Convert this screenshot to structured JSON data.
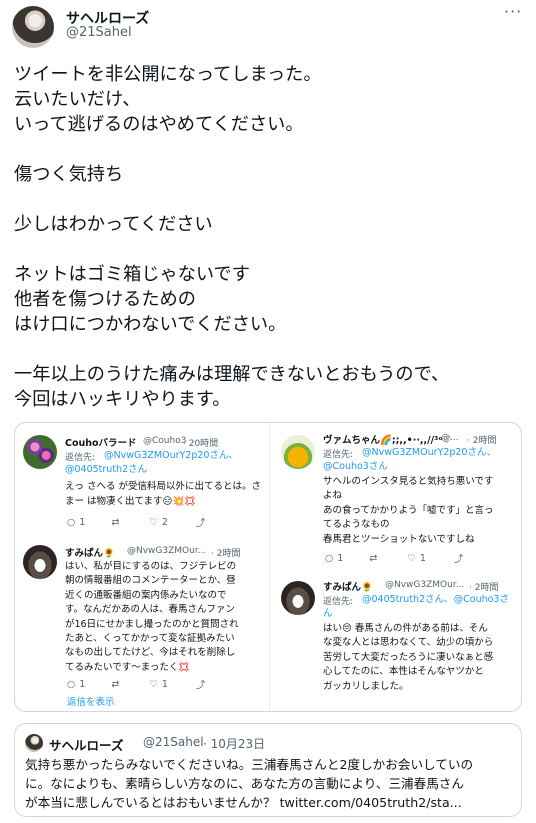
{
  "author": {
    "name": "サヘルローズ",
    "handle": "@21Sahel"
  },
  "more_label": "···",
  "body_lines": [
    "ツイートを非公開になってしまった。",
    "云いたいだけ、",
    "いって逃げるのはやめてください。",
    "",
    "傷つく気持ち",
    "",
    "少しはわかってください",
    "",
    "ネットはゴミ箱じゃないです",
    "他者を傷つけるための",
    "はけ口につかわないでください。",
    "",
    "一年以上のうけた痛みは理解できないとおもうので、",
    "今回はハッキリやります。"
  ],
  "screenshot": {
    "left": {
      "reply1": {
        "name": "Couhoバラード",
        "handle": "@Couho3",
        "time": "· 20時間",
        "reply_prefix": "返信先:",
        "reply_to1": "@NvwG3ZMOurY2p20さん、",
        "reply_to2": "@0405truth2さん",
        "text1": "えっ さへる が受信料局以外に出てるとは。さまー は物凄く出てます😑💥💢",
        "acts": {
          "reply": "1",
          "like": "2"
        }
      },
      "reply2": {
        "name": "すみぱん🌻",
        "handle": "@NvwG3ZMOur...",
        "time": "· 2時間",
        "lines": [
          "はい、私が目にするのは、フジテレビの",
          "朝の情報番組のコメンテーターとか、昼",
          "近くの通販番組の案内係みたいなので",
          "す。なんだかあの人は、春馬さんファン",
          "が16日にせかまし撮ったのかと質問され",
          "たあと、くってかかって変な証拠みたい",
          "なもの出してたけど、今はそれを削除し",
          "てるみたいです〜まったく💢"
        ],
        "acts": {
          "reply": "1",
          "like": "1"
        },
        "show_replies": "返信を表示"
      }
    },
    "right": {
      "reply1": {
        "name": "ヴァムちゃん🌈;;,,•··,,//³ᵒ♡",
        "handle": "@...",
        "time": "· 2時間",
        "reply_prefix": "返信先:",
        "reply_to1": "@NvwG3ZMOurY2p20さん、",
        "reply_to2": "@Couho3さん",
        "lines": [
          "サヘルのインスタ見ると気持ち悪いです",
          "よね",
          "あの食ってかかりよう「嘘です」と言っ",
          "てるようなもの",
          "春馬君とツーショットないですしね"
        ],
        "acts": {
          "reply": "1",
          "like": "1"
        }
      },
      "reply2": {
        "name": "すみぱん🌻",
        "handle": "@NvwG3ZMOur...",
        "time": "· 2時間",
        "reply_prefix": "返信先:",
        "reply_to1": "@0405truth2さん、@Couho3さ",
        "reply_to2": "ん",
        "lines": [
          "はい😔  春馬さんの件がある前は、そん",
          "な変な人とは思わなくて、幼少の頃から",
          "苦労して大変だったろうに凄いなぁと感",
          "心してたのに、本性はそんなヤツかと",
          "ガッカリしました。"
        ]
      }
    }
  },
  "quote": {
    "name": "サヘルローズ",
    "handle": "@21Sahel",
    "date": "· 10月23日",
    "lines": [
      "気持ち悪かったらみないでくださいね。三浦春馬さんと2度しかお会いしていの",
      "に。なによりも、素晴らしい方なのに、あなた方の言動により、三浦春馬さん",
      "が本当に悲しんでいるとはおもいませんか？ twitter.com/0405truth2/sta..."
    ]
  },
  "colors": {
    "accent": "#1d9bf0",
    "secondary": "#536471",
    "border": "#cfd9de"
  }
}
